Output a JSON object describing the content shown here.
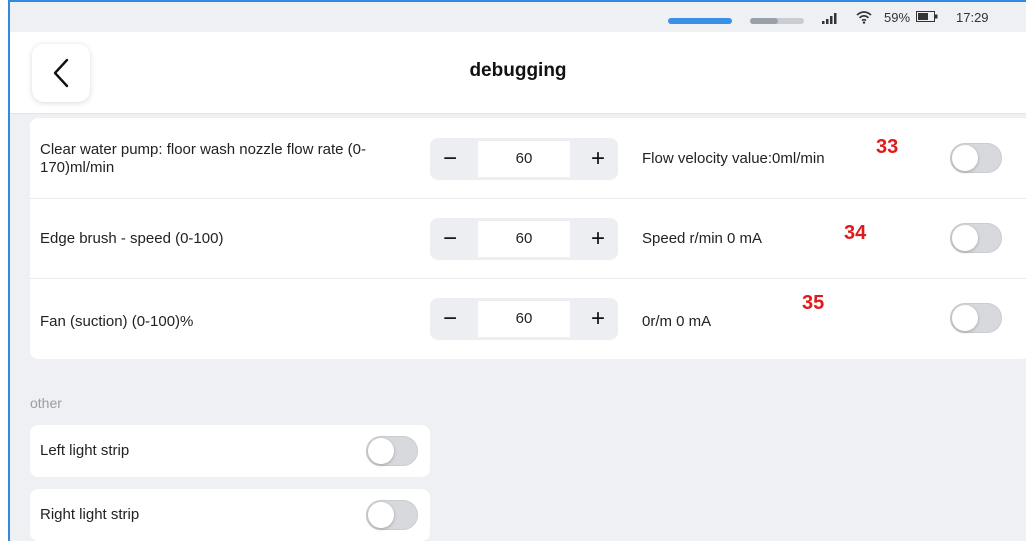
{
  "status_bar": {
    "battery_percent": "59%",
    "time": "17:29",
    "icons": [
      "signal-icon",
      "wifi-icon",
      "battery-icon"
    ]
  },
  "header": {
    "title": "debugging",
    "back_icon": "chevron-left-icon"
  },
  "settings": [
    {
      "label": "Clear water pump: floor wash nozzle flow rate (0-170)ml/min",
      "value": "60",
      "minus": "−",
      "plus": "+",
      "readout": "Flow velocity value:0ml/min",
      "marker": "33",
      "toggle_on": false
    },
    {
      "label": "Edge brush - speed (0-100)",
      "value": "60",
      "minus": "−",
      "plus": "+",
      "readout": "Speed r/min 0 mA",
      "marker": "34",
      "toggle_on": false
    },
    {
      "label": "Fan (suction) (0-100)%",
      "value": "60",
      "minus": "−",
      "plus": "+",
      "readout": "0r/m 0 mA",
      "marker": "35",
      "toggle_on": false
    }
  ],
  "other": {
    "section_title": "other",
    "items": [
      {
        "label": "Left light strip",
        "toggle_on": false
      },
      {
        "label": "Right light strip",
        "toggle_on": false
      }
    ]
  },
  "colors": {
    "accent": "#3a8fe6",
    "marker": "#e01919",
    "background": "#eef0f4"
  }
}
